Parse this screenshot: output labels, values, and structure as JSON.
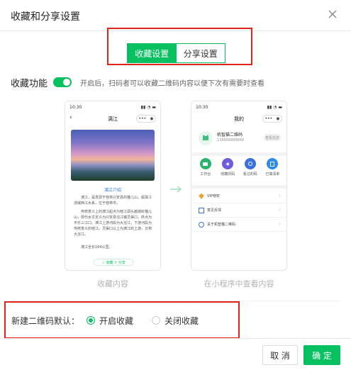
{
  "dialog": {
    "title": "收藏和分享设置"
  },
  "tabs": [
    {
      "label": "收藏设置",
      "active": true
    },
    {
      "label": "分享设置",
      "active": false
    }
  ],
  "favorite": {
    "label": "收藏功能",
    "enabled": true,
    "description": "开启后，扫码者可以收藏二维码内容以便下次有需要时查看"
  },
  "phone_left": {
    "time": "10:30",
    "nav_title": "漓江",
    "photo_caption": "漓江介绍",
    "paragraphs": [
      "漓江，是发源于桂林兴安县的猫儿山，属珠江流域西江水系，位于桂林市。",
      "传统意义上的漓江起点为桂江源头越城岭猫儿山，现代水文定义为兴安县溶江镇灵渠口，终点为平乐三江口。漓江上游河段为大溶江，下游河段为传统意义的桂江。灵渠口以上为漓江的上游，又称大溶江。",
      "漓江全长164公里。"
    ],
    "buttons": "☆ 收藏   ⇪ 分享",
    "caption": "收藏内容"
  },
  "phone_right": {
    "time": "10:30",
    "nav_title": "我的",
    "profile_name": "机智猫二维码",
    "profile_id": "138888888888",
    "profile_button": "查看信息",
    "grid": [
      {
        "label": "工作台",
        "icon": "workbench-icon",
        "color": "#27b46b"
      },
      {
        "label": "收藏的码",
        "icon": "star-icon",
        "color": "#6c5cd9"
      },
      {
        "label": "看过的码",
        "icon": "eye-icon",
        "color": "#3a6fe0"
      },
      {
        "label": "已填清单",
        "icon": "list-icon",
        "color": "#2c8df0"
      }
    ],
    "list": [
      {
        "label": "VIP特权",
        "icon": "vip-icon"
      },
      {
        "label": "意见反馈",
        "icon": "feedback-icon"
      },
      {
        "label": "关于机智猫二维码",
        "icon": "info-icon"
      }
    ],
    "caption": "在小程序中查看内容"
  },
  "default_setting": {
    "label": "新建二维码默认：",
    "options": [
      {
        "label": "开启收藏",
        "selected": true
      },
      {
        "label": "关闭收藏",
        "selected": false
      }
    ]
  },
  "footer": {
    "cancel": "取 消",
    "confirm": "确 定"
  },
  "colors": {
    "accent": "#07c160",
    "highlight": "#e2231a"
  }
}
